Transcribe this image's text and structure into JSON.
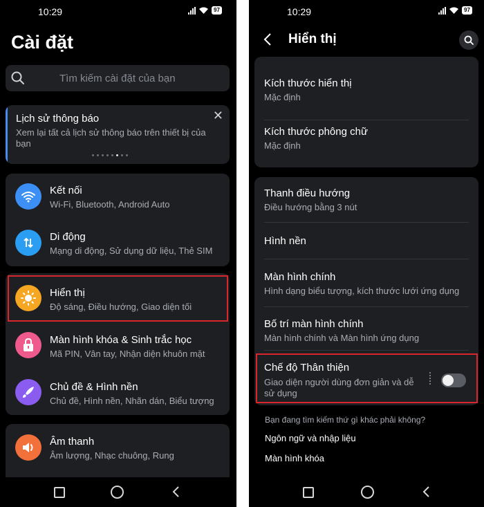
{
  "left": {
    "status": {
      "time": "10:29",
      "battery": "97"
    },
    "title": "Cài đặt",
    "search_placeholder": "Tìm kiếm cài đặt của bạn",
    "notification_card": {
      "title": "Lịch sử thông báo",
      "description": "Xem lại tất cả lịch sử thông báo trên thiết bị của bạn",
      "close": "✕"
    },
    "items": [
      {
        "title": "Kết nối",
        "subtitle": "Wi-Fi, Bluetooth, Android Auto",
        "icon": "wifi-icon",
        "color": "#3c8ff5"
      },
      {
        "title": "Di động",
        "subtitle": "Mạng di động, Sử dụng dữ liệu, Thẻ SIM",
        "icon": "data-transfer-icon",
        "color": "#2a9ef2"
      },
      {
        "title": "Hiển thị",
        "subtitle": "Độ sáng, Điều hướng, Giao diện tối",
        "icon": "sun-icon",
        "color": "#f5a623"
      },
      {
        "title": "Màn hình khóa & Sinh trắc học",
        "subtitle": "Mã PIN, Vân tay, Nhận diện khuôn mặt",
        "icon": "lock-icon",
        "color": "#ef5a8c"
      },
      {
        "title": "Chủ đề & Hình nền",
        "subtitle": "Chủ đề, Hình nền, Nhãn dán, Biểu tượng",
        "icon": "brush-icon",
        "color": "#8b5cf0"
      },
      {
        "title": "Âm thanh",
        "subtitle": "Âm lượng, Nhạc chuông, Rung",
        "icon": "speaker-icon",
        "color": "#f2713b"
      }
    ]
  },
  "right": {
    "status": {
      "time": "10:29",
      "battery": "97"
    },
    "title": "Hiển thị",
    "group1": [
      {
        "title": "Kích thước hiển thị",
        "subtitle": "Mặc định"
      },
      {
        "title": "Kích thước phông chữ",
        "subtitle": "Mặc định"
      }
    ],
    "group2": [
      {
        "title": "Thanh điều hướng",
        "subtitle": "Điều hướng bằng 3 nút"
      },
      {
        "title": "Hình nền",
        "subtitle": ""
      },
      {
        "title": "Màn hình chính",
        "subtitle": "Hình dạng biểu tượng, kích thước lưới ứng dụng"
      },
      {
        "title": "Bố trí màn hình chính",
        "subtitle": "Màn hình chính và Màn hình ứng dụng"
      }
    ],
    "friendly_mode": {
      "title": "Chế độ Thân thiện",
      "subtitle_line1": "Giao diện người dùng đơn giản và dễ",
      "subtitle_line2": "sử dụng",
      "enabled": false
    },
    "suggestions": {
      "hint": "Bạn đang tìm kiếm thứ gì khác phải không?",
      "links": [
        "Ngôn ngữ và nhập liệu",
        "Màn hình khóa"
      ]
    }
  },
  "colors": {
    "highlight": "#d9262c",
    "card": "#1e1f23",
    "background": "#000000"
  }
}
